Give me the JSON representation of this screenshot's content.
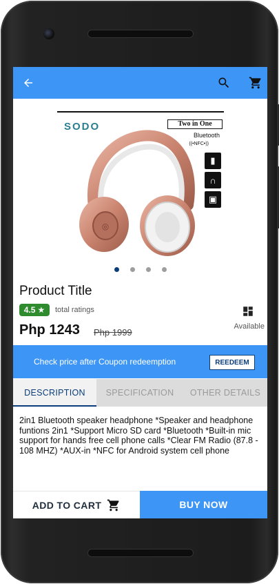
{
  "app_bar": {
    "back_icon": "arrow-left-icon",
    "search_icon": "search-icon",
    "cart_icon": "cart-icon",
    "color": "#3d96f5"
  },
  "product": {
    "image": {
      "brand": "SODO",
      "badge": "Two in One",
      "bluetooth": "Bluetooth",
      "nfc": "((•NFC•))"
    },
    "carousel": {
      "count": 4,
      "active_index": 0
    },
    "title": "Product Title",
    "rating": "4.5",
    "rating_label": "total ratings",
    "availability_icon": "grid-icon",
    "availability": "Available",
    "price": "Php 1243",
    "old_price": "Php 1999"
  },
  "coupon": {
    "text": "Check price after Coupon redeemption",
    "button": "REEDEEM"
  },
  "tabs": [
    {
      "label": "DESCRIPTION",
      "active": true
    },
    {
      "label": "SPECIFICATION",
      "active": false
    },
    {
      "label": "OTHER DETAILS",
      "active": false
    }
  ],
  "description": "2in1 Bluetooth speaker headphone *Speaker and headphone funtions 2in1 *Support Micro SD card *Bluetooth *Built-in mic support for hands free cell phone calls *Clear FM Radio (87.8 - 108 MHZ) *AUX-in *NFC for Android system cell phone",
  "bottom_bar": {
    "add_to_cart": "ADD TO CART",
    "buy_now": "BUY NOW"
  }
}
